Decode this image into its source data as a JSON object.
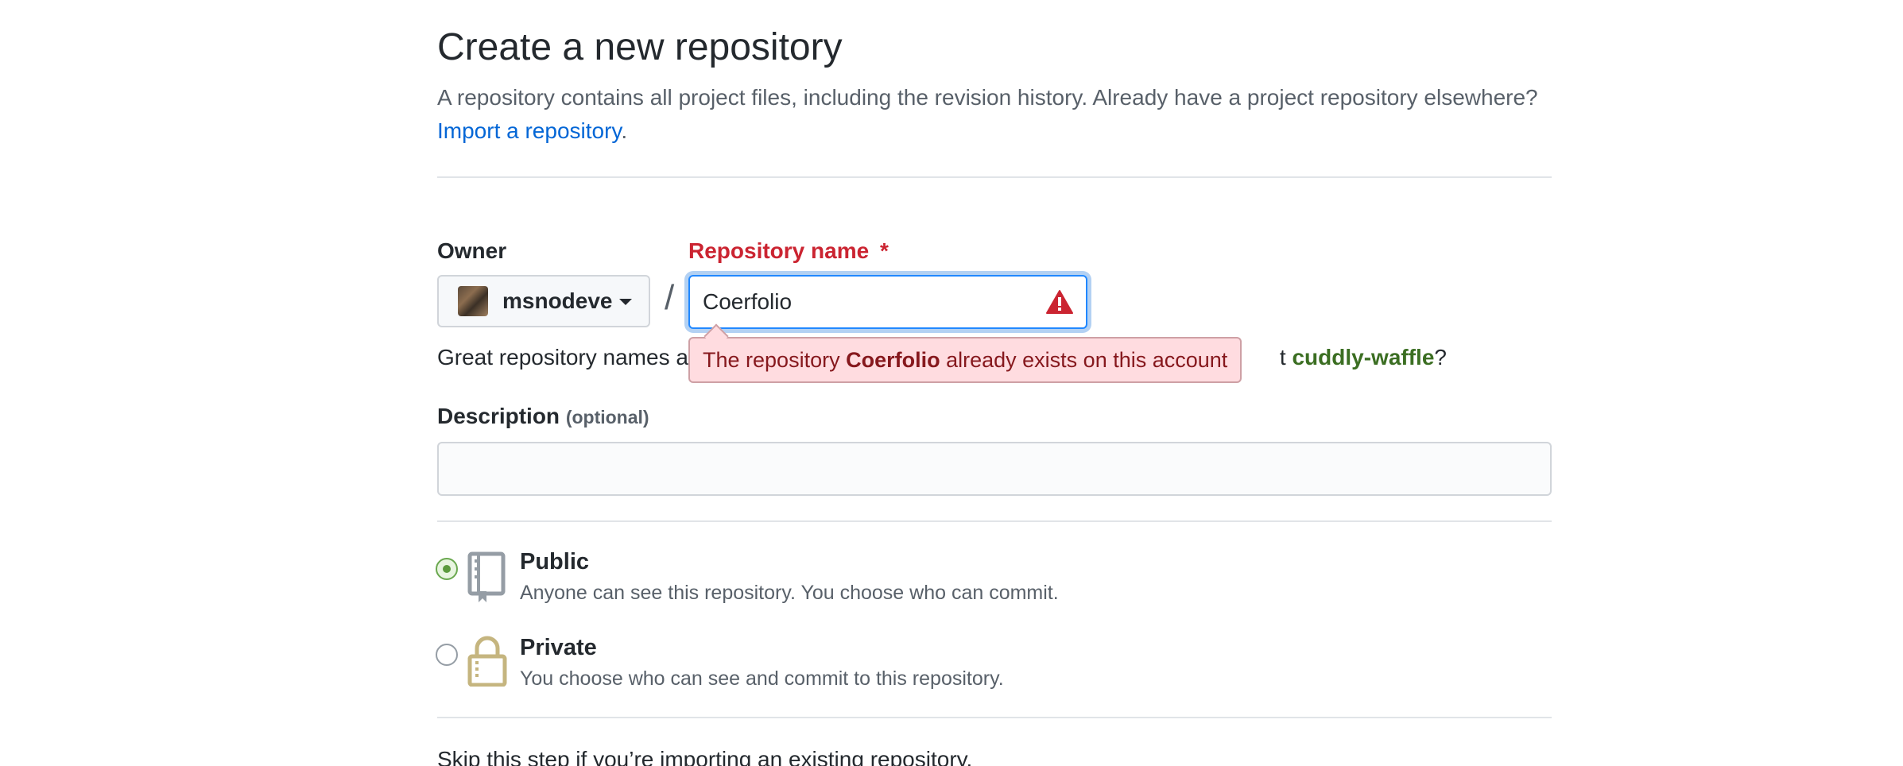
{
  "page": {
    "title": "Create a new repository",
    "subtitle": "A repository contains all project files, including the revision history. Already have a project repository elsewhere?",
    "import_link": "Import a repository",
    "import_suffix": "."
  },
  "owner": {
    "label": "Owner",
    "name": "msnodeve",
    "separator": "/"
  },
  "repo_name": {
    "label": "Repository name",
    "required_mark": "*",
    "value": "Coerfolio",
    "warning_icon": "alert-triangle-icon"
  },
  "error_popup": {
    "prefix": "The repository",
    "repo": "Coerfolio",
    "suffix": "already exists on this account"
  },
  "hint": {
    "prefix": "Great repository names a",
    "mid": "t",
    "suggestion": "cuddly-waffle",
    "suffix": "?"
  },
  "description": {
    "label": "Description",
    "optional": "(optional)",
    "value": ""
  },
  "visibility": {
    "options": [
      {
        "title": "Public",
        "desc": "Anyone can see this repository. You choose who can commit.",
        "icon": "repo-book-icon",
        "selected": true
      },
      {
        "title": "Private",
        "desc": "You choose who can see and commit to this repository.",
        "icon": "lock-icon",
        "selected": false
      }
    ]
  },
  "skip_text": "Skip this step if you’re importing an existing repository.",
  "colors": {
    "link": "#0366d6",
    "error": "#cb2431",
    "focus": "#2188ff",
    "suggestion": "#3b6e22",
    "radio_checked": "#5b9a3d"
  }
}
